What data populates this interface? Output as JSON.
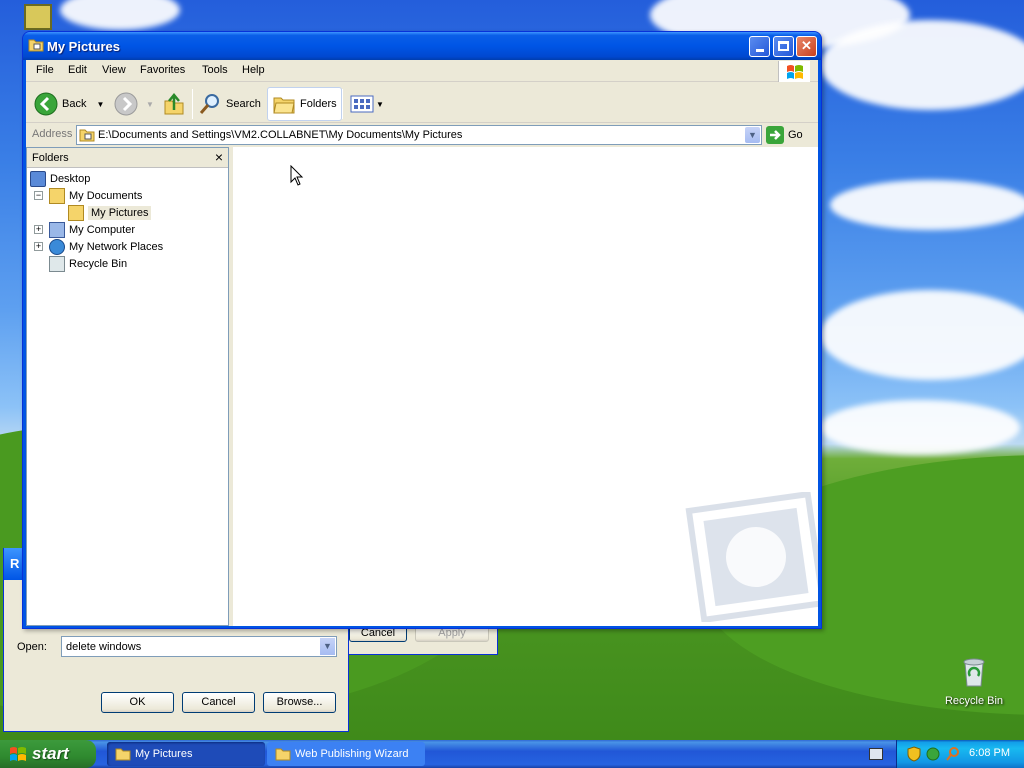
{
  "desktop": {
    "recycle_bin_label": "Recycle Bin"
  },
  "run_dialog": {
    "title_fragment": "R",
    "open_label": "Open:",
    "open_value": "delete windows",
    "ok_label": "OK",
    "cancel_label": "Cancel",
    "browse_label": "Browse..."
  },
  "wizard_dialog": {
    "cancel_label": "Cancel",
    "apply_label": "Apply"
  },
  "window": {
    "title": "My Pictures",
    "menu": [
      "File",
      "Edit",
      "View",
      "Favorites",
      "Tools",
      "Help"
    ],
    "toolbar": {
      "back_label": "Back",
      "search_label": "Search",
      "folders_label": "Folders"
    },
    "address": {
      "label": "Address",
      "value": "E:\\Documents and Settings\\VM2.COLLABNET\\My Documents\\My Pictures",
      "go_label": "Go"
    },
    "folders_pane": {
      "title": "Folders",
      "close_glyph": "×",
      "items": [
        {
          "label": "Desktop"
        },
        {
          "label": "My Documents",
          "expander": "−"
        },
        {
          "label": "My Pictures"
        },
        {
          "label": "My Computer",
          "expander": "+"
        },
        {
          "label": "My Network Places",
          "expander": "+"
        },
        {
          "label": "Recycle Bin"
        }
      ]
    }
  },
  "taskbar": {
    "start_label": "start",
    "tasks": [
      {
        "label": "My Pictures"
      },
      {
        "label": "Web Publishing Wizard"
      }
    ],
    "clock": "6:08 PM"
  },
  "colors": {
    "titlebar": "#0055e5",
    "taskbar": "#2157d7",
    "start": "#2f8a2f",
    "tray": "#18b9f0"
  }
}
